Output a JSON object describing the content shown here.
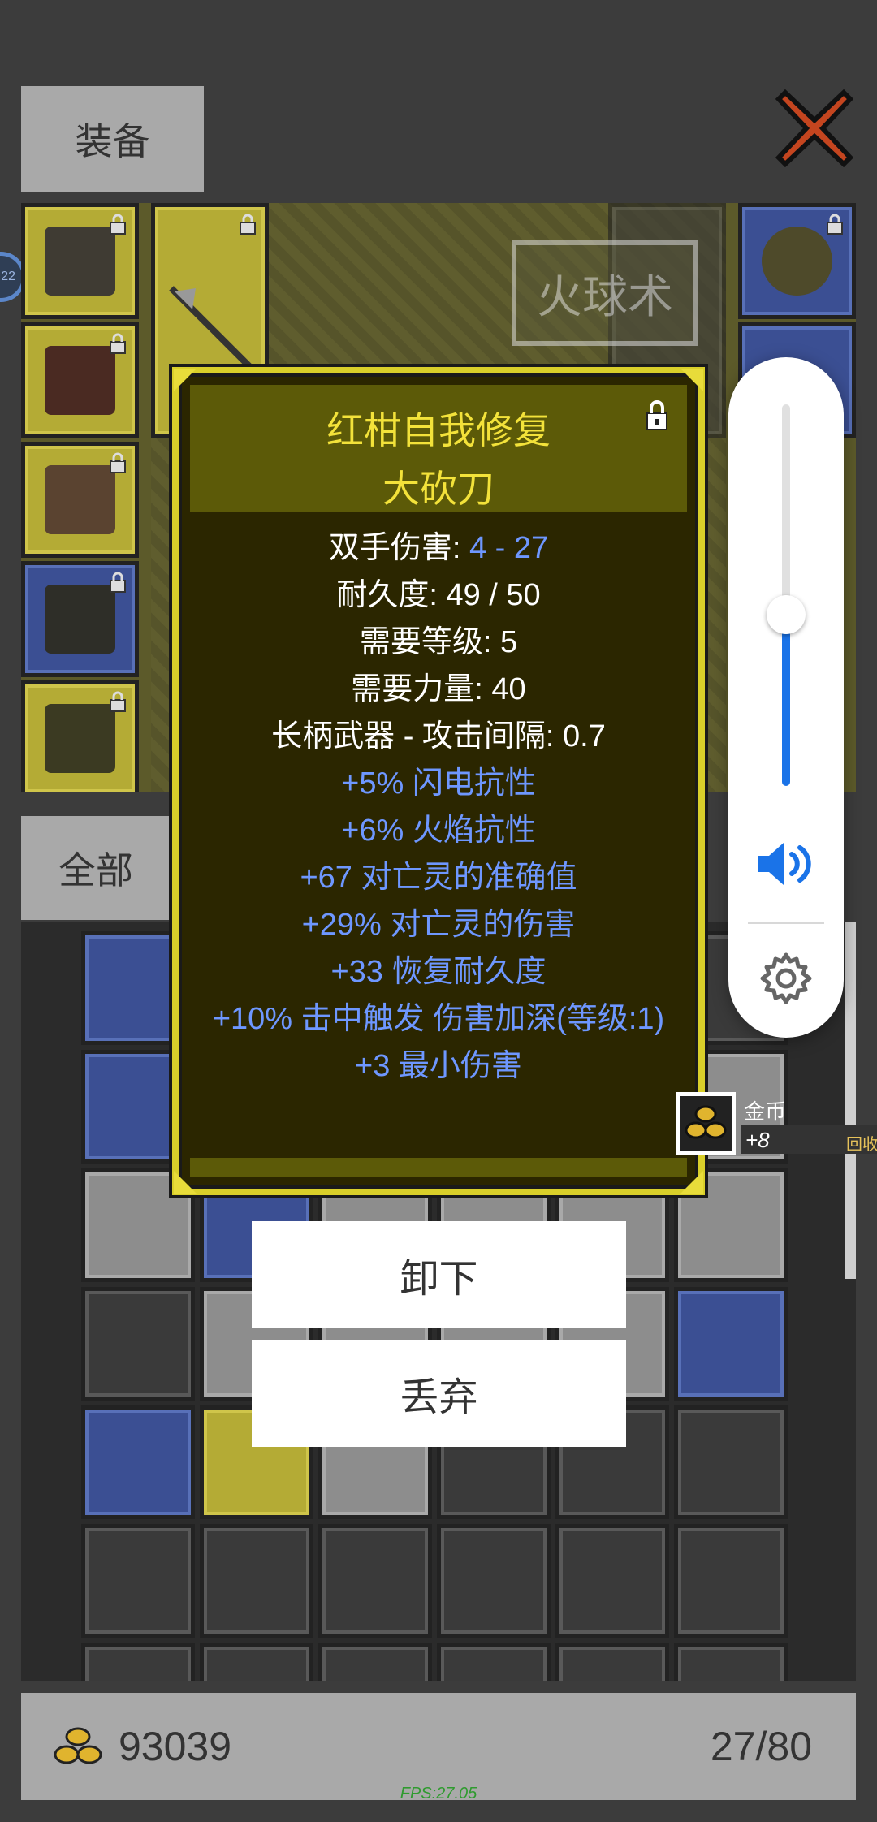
{
  "header": {
    "equip_tab": "装备"
  },
  "skill_bubble": {
    "label": "火球术"
  },
  "inventory": {
    "filter_tab": "全部"
  },
  "tooltip": {
    "prefix": "红柑自我修复",
    "name": "大砍刀",
    "stats": {
      "damage_label": "双手伤害: ",
      "damage_value": "4 - 27",
      "durability": "耐久度: 49 / 50",
      "req_level": "需要等级: 5",
      "req_str": "需要力量: 40",
      "weapon_type": "长柄武器 - 攻击间隔: 0.7"
    },
    "affixes": [
      "+5% 闪电抗性",
      "+6% 火焰抗性",
      "+67 对亡灵的准确值",
      "+29% 对亡灵的伤害",
      "+33 恢复耐久度",
      "+10% 击中触发 伤害加深(等级:1)",
      "+3 最小伤害"
    ]
  },
  "actions": {
    "unequip": "卸下",
    "drop": "丢弃"
  },
  "coin_toast": {
    "title": "金币",
    "amount": "+8",
    "recycle": "回收"
  },
  "footer": {
    "gold": "93039",
    "capacity": "27/80"
  },
  "fps": "FPS:27.05",
  "left_badge": "22",
  "volume": {
    "level_fraction": 0.45
  },
  "colors": {
    "rare_text": "#f3e23a",
    "magic_text": "#6e97ff",
    "tooltip_border": "#d9cf2a",
    "volume_accent": "#1a73e8"
  },
  "icons": [
    "close-x-icon",
    "lock-icon",
    "coin-icon",
    "speaker-icon",
    "gear-icon"
  ]
}
